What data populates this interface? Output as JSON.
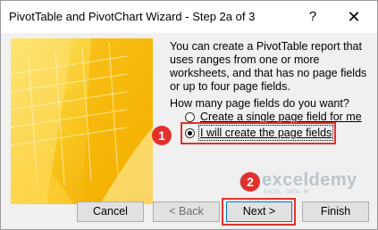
{
  "window": {
    "title": "PivotTable and PivotChart Wizard - Step 2a of 3",
    "help_glyph": "?",
    "close_glyph": "✕"
  },
  "content": {
    "description": "You can create a PivotTable report that uses ranges from one or more worksheets, and that has no page fields or up to four page fields.",
    "question": "How many page fields do you want?",
    "options": [
      {
        "label": "Create a single page field for me",
        "selected": false
      },
      {
        "label": "I will create the page fields",
        "selected": true
      }
    ]
  },
  "annotations": {
    "badge1": "1",
    "badge2": "2",
    "highlight_color": "#e2312d"
  },
  "buttons": {
    "cancel": "Cancel",
    "back": "< Back",
    "next": "Next >",
    "finish": "Finish"
  },
  "watermark": {
    "name": "exceldemy",
    "tagline": "EXCEL · DATA · BI"
  },
  "colors": {
    "art_yellow": "#f4b400",
    "focus_blue": "#0078d7"
  }
}
